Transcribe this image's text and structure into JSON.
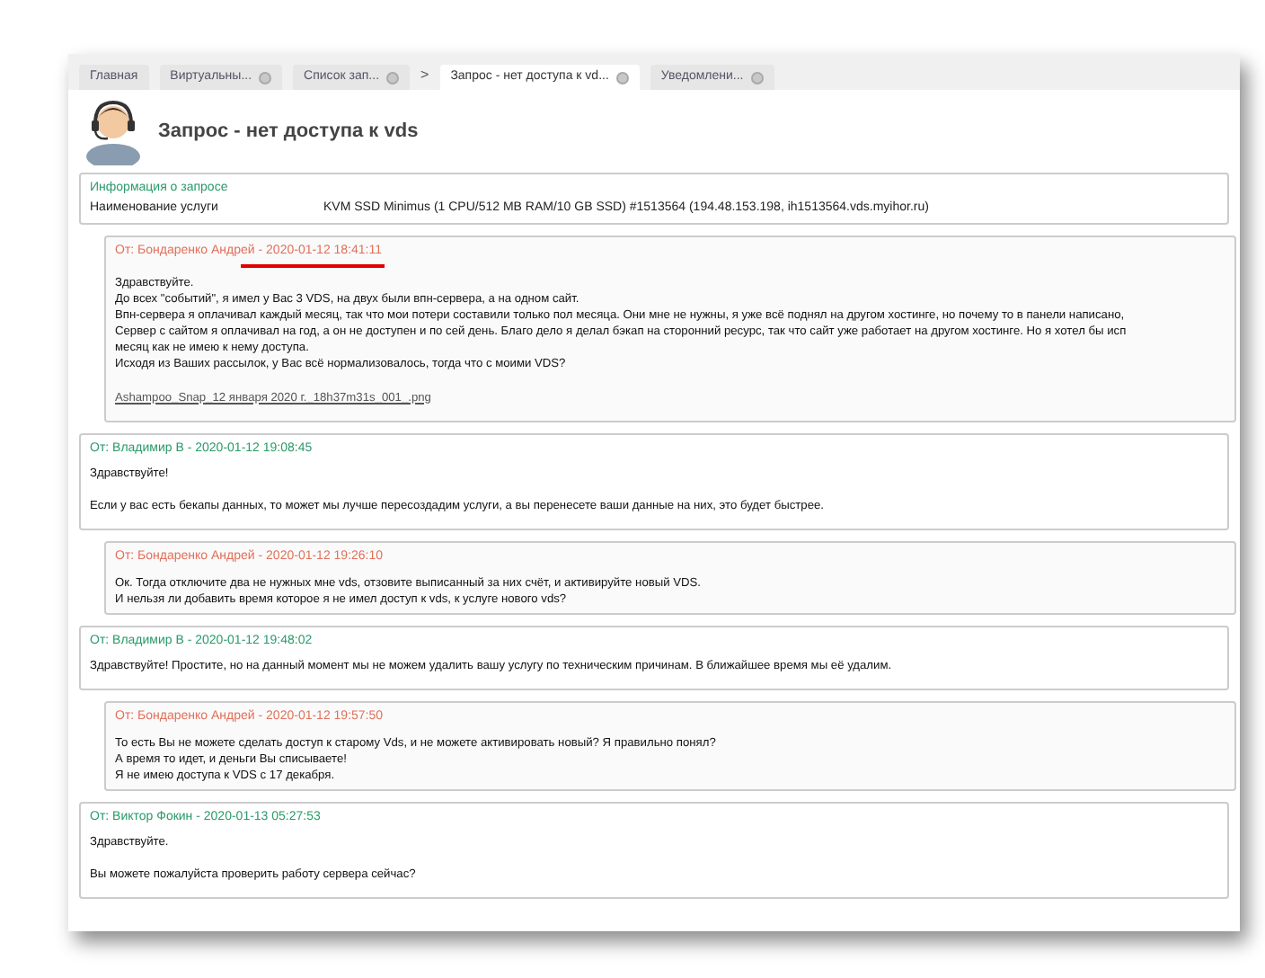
{
  "tabs": [
    {
      "label": "Главная",
      "selected": false,
      "closable": false
    },
    {
      "label": "Виртуальны...",
      "selected": false,
      "closable": true
    },
    {
      "label": "Список зап...",
      "selected": false,
      "closable": true,
      "arrow": ">"
    },
    {
      "label": "Запрос - нет доступа к vd...",
      "selected": true,
      "closable": true
    },
    {
      "label": "Уведомлени...",
      "selected": false,
      "closable": true
    }
  ],
  "title": "Запрос - нет доступа к vds",
  "info": {
    "heading": "Информация о запросе",
    "rows": [
      {
        "label": "Наименование услуги",
        "value": "KVM SSD Minimus (1 CPU/512 MB RAM/10 GB SSD) #1513564 (194.48.153.198, ih1513564.vds.myihor.ru)"
      }
    ]
  },
  "messages": [
    {
      "kind": "client",
      "header": "От: Бондаренко Андрей - 2020-01-12 18:41:11",
      "underlined": true,
      "paragraphs": [
        [
          "Здравствуйте.",
          "До всех \"событий\", я имел у Вас 3 VDS, на двух были впн-сервера, а на одном сайт.",
          "Впн-сервера я оплачивал каждый месяц, так что мои потери составили только пол месяца. Они мне не нужны, я уже всё поднял на другом хостинге, но почему то в панели написано,",
          "Сервер с сайтом я оплачивал на год, а он не доступен и по сей день. Благо дело я делал бэкап на сторонний ресурс, так что сайт уже работает на другом хостинге. Но я хотел бы исп",
          "месяц как не имею к нему доступа.",
          "Исходя из Ваших рассылок, у Вас всё нормализовалось, тогда что с моими VDS?"
        ]
      ],
      "attachment": "Ashampoo_Snap_12 января 2020 г._18h37m31s_001_.png"
    },
    {
      "kind": "support",
      "header": "От: Владимир В - 2020-01-12 19:08:45",
      "underlined": false,
      "paragraphs": [
        [
          "Здравствуйте!"
        ],
        [
          "Если у вас есть бекапы данных, то может мы лучше пересоздадим услуги, а вы перенесете ваши данные на них, это будет быстрее."
        ]
      ]
    },
    {
      "kind": "client",
      "header": "От: Бондаренко Андрей - 2020-01-12 19:26:10",
      "underlined": false,
      "paragraphs": [
        [
          "Ок. Тогда отключите два не нужных мне vds, отзовите выписанный за них счёт, и активируйте новый VDS.",
          "И нельзя ли добавить время которое я не имел доступ к vds, к услуге нового vds?"
        ]
      ]
    },
    {
      "kind": "support",
      "header": "От: Владимир В - 2020-01-12 19:48:02",
      "underlined": false,
      "paragraphs": [
        [
          "Здравствуйте! Простите, но на данный момент мы не можем удалить вашу услугу по техническим причинам. В ближайшее время мы её удалим."
        ]
      ]
    },
    {
      "kind": "client",
      "header": "От: Бондаренко Андрей - 2020-01-12 19:57:50",
      "underlined": false,
      "paragraphs": [
        [
          "То есть Вы не можете сделать доступ к старому Vds, и не можете активировать новый? Я правильно понял?",
          "А время то идет, и деньги Вы списываете!",
          "Я не имею доступа к VDS с 17 декабря."
        ]
      ]
    },
    {
      "kind": "support",
      "header": "От: Виктор Фокин - 2020-01-13 05:27:53",
      "underlined": false,
      "paragraphs": [
        [
          "Здравствуйте."
        ],
        [
          "Вы можете пожалуйста проверить работу сервера сейчас?"
        ]
      ]
    }
  ]
}
